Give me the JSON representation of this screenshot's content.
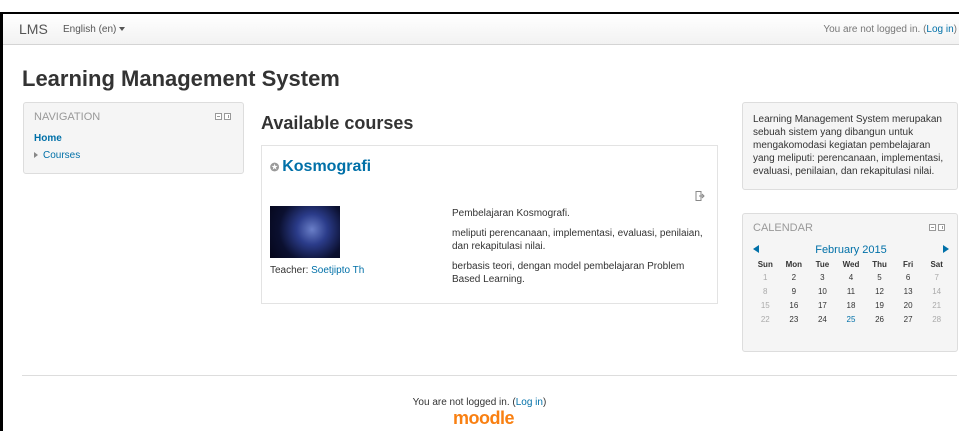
{
  "navbar": {
    "brand": "LMS",
    "language": "English (en)",
    "login_prefix": "You are not logged in. (",
    "login_link": "Log in",
    "login_suffix": ")"
  },
  "page_title": "Learning Management System",
  "navigation": {
    "title": "NAVIGATION",
    "home": "Home",
    "courses": "Courses"
  },
  "main": {
    "title": "Available courses",
    "course": {
      "name": "Kosmografi",
      "teacher_label": "Teacher: ",
      "teacher_name": "Soetjipto Th",
      "summary": [
        "Pembelajaran Kosmografi.",
        "meliputi perencanaan, implementasi, evaluasi, penilaian, dan rekapitulasi nilai.",
        "berbasis teori, dengan model pembelajaran Problem Based Learning."
      ]
    }
  },
  "side_text": "Learning Management System merupakan sebuah sistem yang dibangun untuk mengakomodasi kegiatan pembelajaran yang meliputi: perencanaan, implementasi, evaluasi, penilaian, dan rekapitulasi nilai.",
  "calendar": {
    "title": "CALENDAR",
    "month": "February 2015",
    "days": [
      "Sun",
      "Mon",
      "Tue",
      "Wed",
      "Thu",
      "Fri",
      "Sat"
    ],
    "weeks": [
      [
        "1",
        "2",
        "3",
        "4",
        "5",
        "6",
        "7"
      ],
      [
        "8",
        "9",
        "10",
        "11",
        "12",
        "13",
        "14"
      ],
      [
        "15",
        "16",
        "17",
        "18",
        "19",
        "20",
        "21"
      ],
      [
        "22",
        "23",
        "24",
        "25",
        "26",
        "27",
        "28"
      ]
    ],
    "today": "25"
  },
  "footer": {
    "login_prefix": "You are not logged in. (",
    "login_link": "Log in",
    "login_suffix": ")",
    "logo": "moodle"
  },
  "colors": {
    "link": "#0070a8",
    "moodle_orange": "#f98012"
  }
}
